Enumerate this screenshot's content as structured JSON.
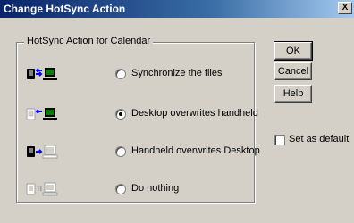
{
  "window": {
    "title": "Change HotSync Action",
    "close_glyph": "X"
  },
  "group": {
    "label": "HotSync Action for Calendar",
    "options": [
      {
        "label": "Synchronize the files",
        "icon": "sync-both-icon",
        "selected": false
      },
      {
        "label": "Desktop overwrites handheld",
        "icon": "desktop-to-handheld-icon",
        "selected": true
      },
      {
        "label": "Handheld overwrites Desktop",
        "icon": "handheld-to-desktop-icon",
        "selected": false
      },
      {
        "label": "Do nothing",
        "icon": "do-nothing-icon",
        "selected": false
      }
    ]
  },
  "buttons": {
    "ok": "OK",
    "cancel": "Cancel",
    "help": "Help"
  },
  "set_default": {
    "label": "Set as default",
    "checked": false
  },
  "colors": {
    "face": "#d4d0c8",
    "title_start": "#0a246a",
    "arrow_blue": "#0000ff",
    "device_green": "#008000",
    "disabled_gray": "#a0a0a0"
  }
}
